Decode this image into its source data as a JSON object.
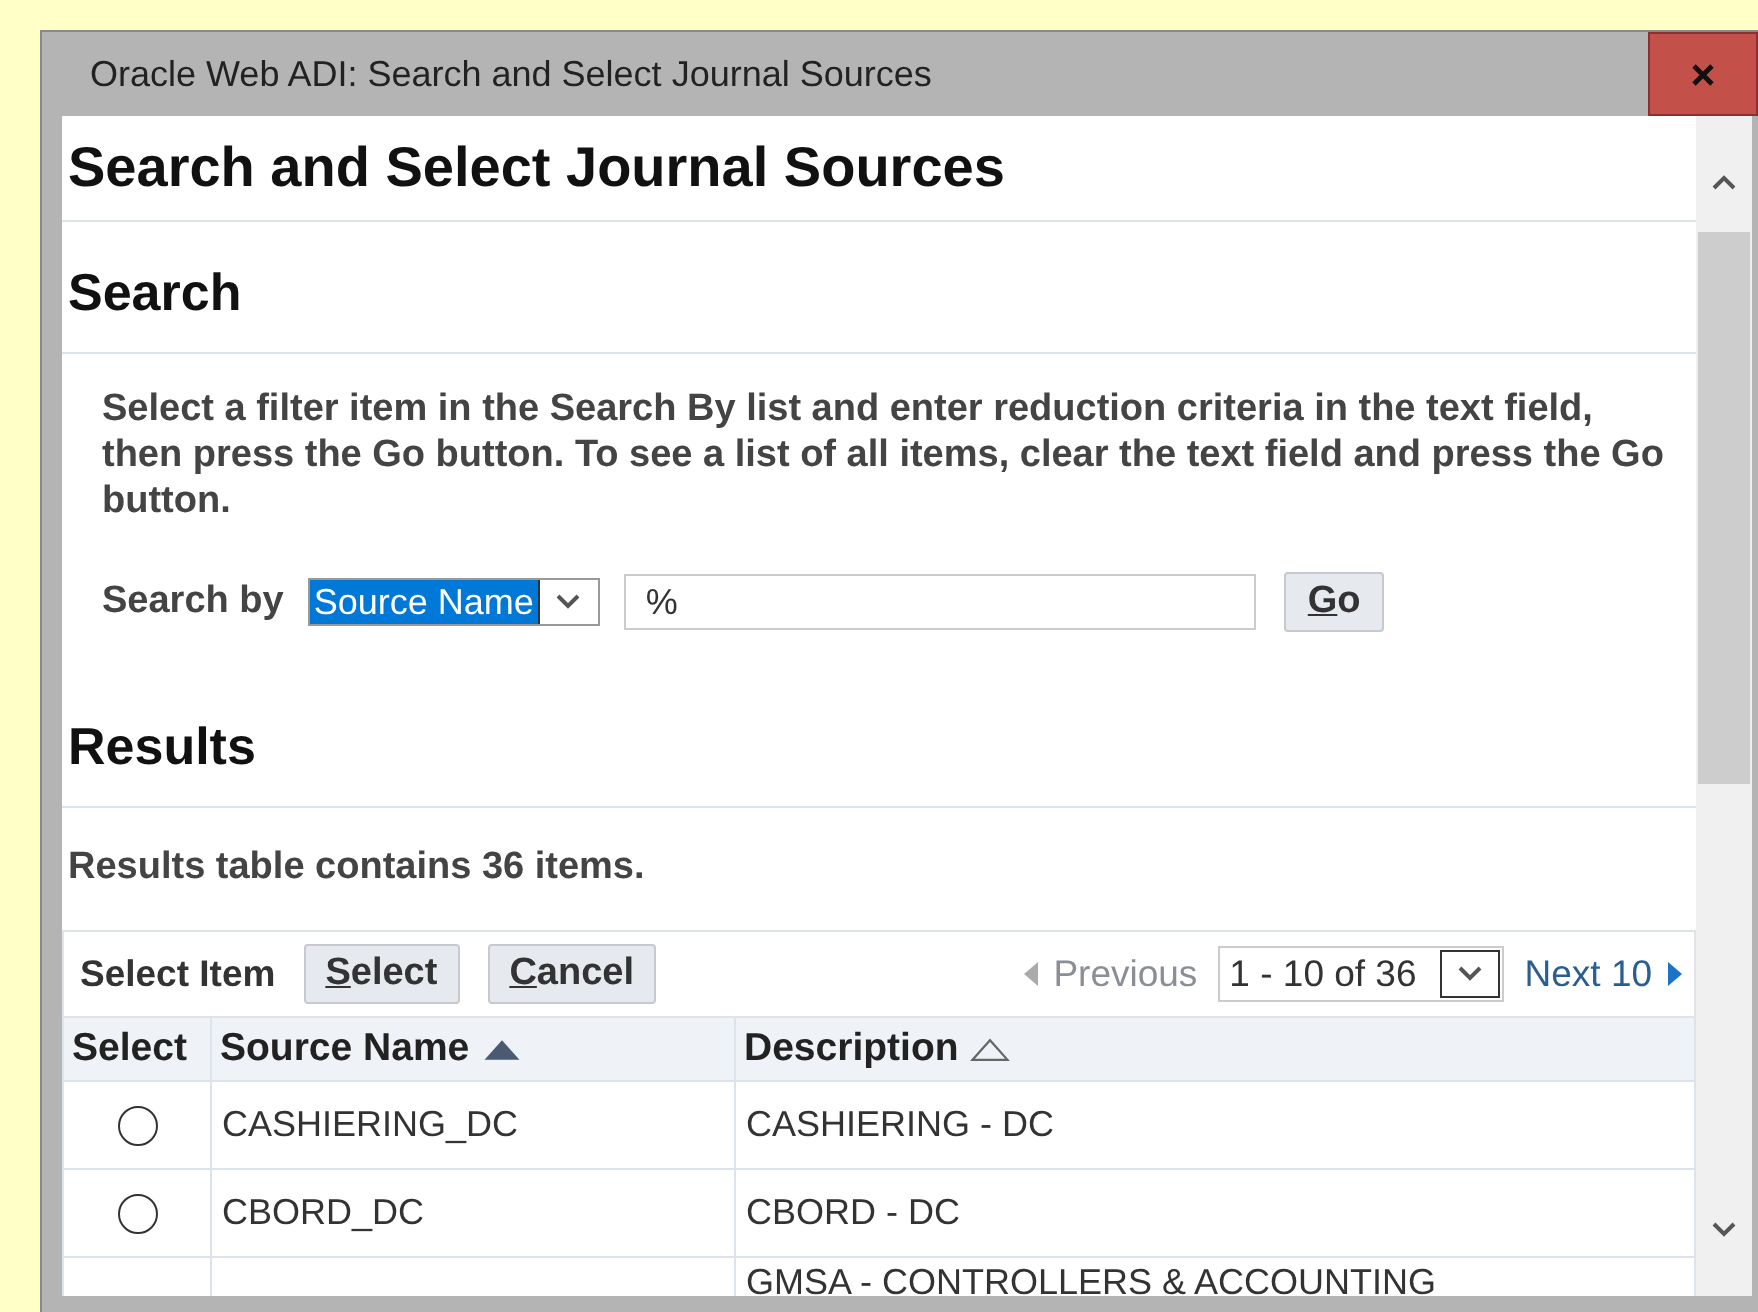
{
  "window": {
    "title": "Oracle Web ADI: Search and Select Journal Sources"
  },
  "page_title": "Search and Select Journal Sources",
  "search": {
    "heading": "Search",
    "instructions": "Select a filter item in the Search By list and enter reduction criteria in the text field, then press the Go button. To see a list of all items, clear the text field and press the Go button.",
    "label": "Search by",
    "search_by": "Source Name",
    "value": "%",
    "go_button": {
      "label": "Go",
      "access_key": true
    }
  },
  "results": {
    "heading": "Results",
    "summary": "Results table contains 36 items.",
    "select_label": "Select Item",
    "buttons": [
      {
        "label": "Select",
        "access_key": true
      },
      {
        "label": "Cancel",
        "access_key": true
      }
    ],
    "pagination": {
      "previous": {
        "label": "Previous",
        "disabled": true
      },
      "range": "1 - 10 of 36",
      "next": {
        "label": "Next 10",
        "disabled": false
      }
    },
    "columns": [
      {
        "label": "Select",
        "sortable": false
      },
      {
        "label": "Source Name",
        "sortable": true,
        "sorted": true
      },
      {
        "label": "Description",
        "sortable": true,
        "sorted": false
      }
    ],
    "rows": [
      {
        "selected": false,
        "source_name": "CASHIERING_DC",
        "description": "CASHIERING - DC"
      },
      {
        "selected": false,
        "source_name": "CBORD_DC",
        "description": "CBORD - DC"
      },
      {
        "description": "GMSA - CONTROLLERS & ACCOUNTING"
      }
    ]
  }
}
